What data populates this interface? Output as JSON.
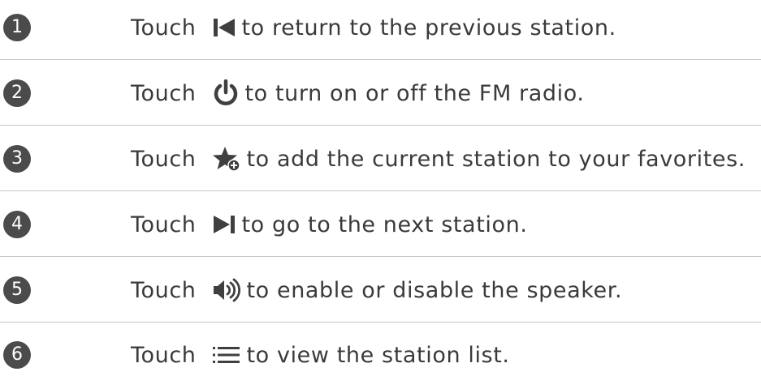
{
  "items": [
    {
      "number": "1",
      "prefix": "Touch",
      "icon": "previous-station-icon",
      "text": "to return to the previous station."
    },
    {
      "number": "2",
      "prefix": "Touch",
      "icon": "power-icon",
      "text": "to turn on or off the FM radio."
    },
    {
      "number": "3",
      "prefix": "Touch",
      "icon": "add-favorite-star-icon",
      "text": "to add the current station to your favorites."
    },
    {
      "number": "4",
      "prefix": "Touch",
      "icon": "next-station-icon",
      "text": "to go to the next station."
    },
    {
      "number": "5",
      "prefix": "Touch",
      "icon": "speaker-icon",
      "text": "to enable or disable the speaker."
    },
    {
      "number": "6",
      "prefix": "Touch",
      "icon": "station-list-icon",
      "text": "to view the station list."
    }
  ]
}
